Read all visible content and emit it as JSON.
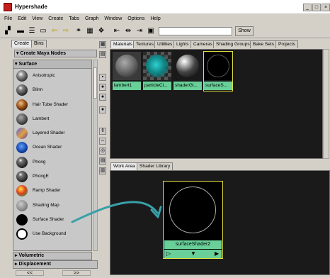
{
  "window": {
    "title": "Hypershade",
    "controls": [
      "_",
      "□",
      "×"
    ]
  },
  "menu": [
    "File",
    "Edit",
    "View",
    "Create",
    "Tabs",
    "Graph",
    "Window",
    "Options",
    "Help"
  ],
  "toolbar": {
    "show_label": "Show"
  },
  "left_panel": {
    "tabs": [
      "Create",
      "Bins"
    ],
    "header": "Create Maya Nodes",
    "section": "Surface",
    "nodes": [
      {
        "label": "Anisotropic",
        "icon": "anisotropic-swatch"
      },
      {
        "label": "Blinn",
        "icon": "blinn-swatch"
      },
      {
        "label": "Hair Tube Shader",
        "icon": "hair-tube-swatch"
      },
      {
        "label": "Lambert",
        "icon": "lambert-swatch"
      },
      {
        "label": "Layered Shader",
        "icon": "layered-swatch"
      },
      {
        "label": "Ocean Shader",
        "icon": "ocean-swatch"
      },
      {
        "label": "Phong",
        "icon": "phong-swatch"
      },
      {
        "label": "PhongE",
        "icon": "phonge-swatch"
      },
      {
        "label": "Ramp Shader",
        "icon": "ramp-swatch"
      },
      {
        "label": "Shading Map",
        "icon": "shading-map-swatch"
      },
      {
        "label": "Surface Shader",
        "icon": "surface-swatch"
      },
      {
        "label": "Use Background",
        "icon": "use-background-swatch"
      }
    ],
    "footer_sections": [
      "Volumetric",
      "Displacement"
    ],
    "nav": [
      "<<",
      ">>"
    ]
  },
  "top_panel": {
    "tabs": [
      "Materials",
      "Textures",
      "Utilities",
      "Lights",
      "Cameras",
      "Shading Groups",
      "Bake Sets",
      "Projects"
    ],
    "tiles": [
      {
        "caption": "lambert1"
      },
      {
        "caption": "particleCl..."
      },
      {
        "caption": "shaderGl..."
      },
      {
        "caption": "surfaceS..."
      }
    ]
  },
  "work_area": {
    "tabs": [
      "Work Area",
      "Shader Library"
    ],
    "node": {
      "caption": "surfaceShader2"
    }
  },
  "colors": {
    "caption_green": "#68d098",
    "selection_yellow": "#e0e040",
    "arrow_teal": "#3aa0a8"
  }
}
